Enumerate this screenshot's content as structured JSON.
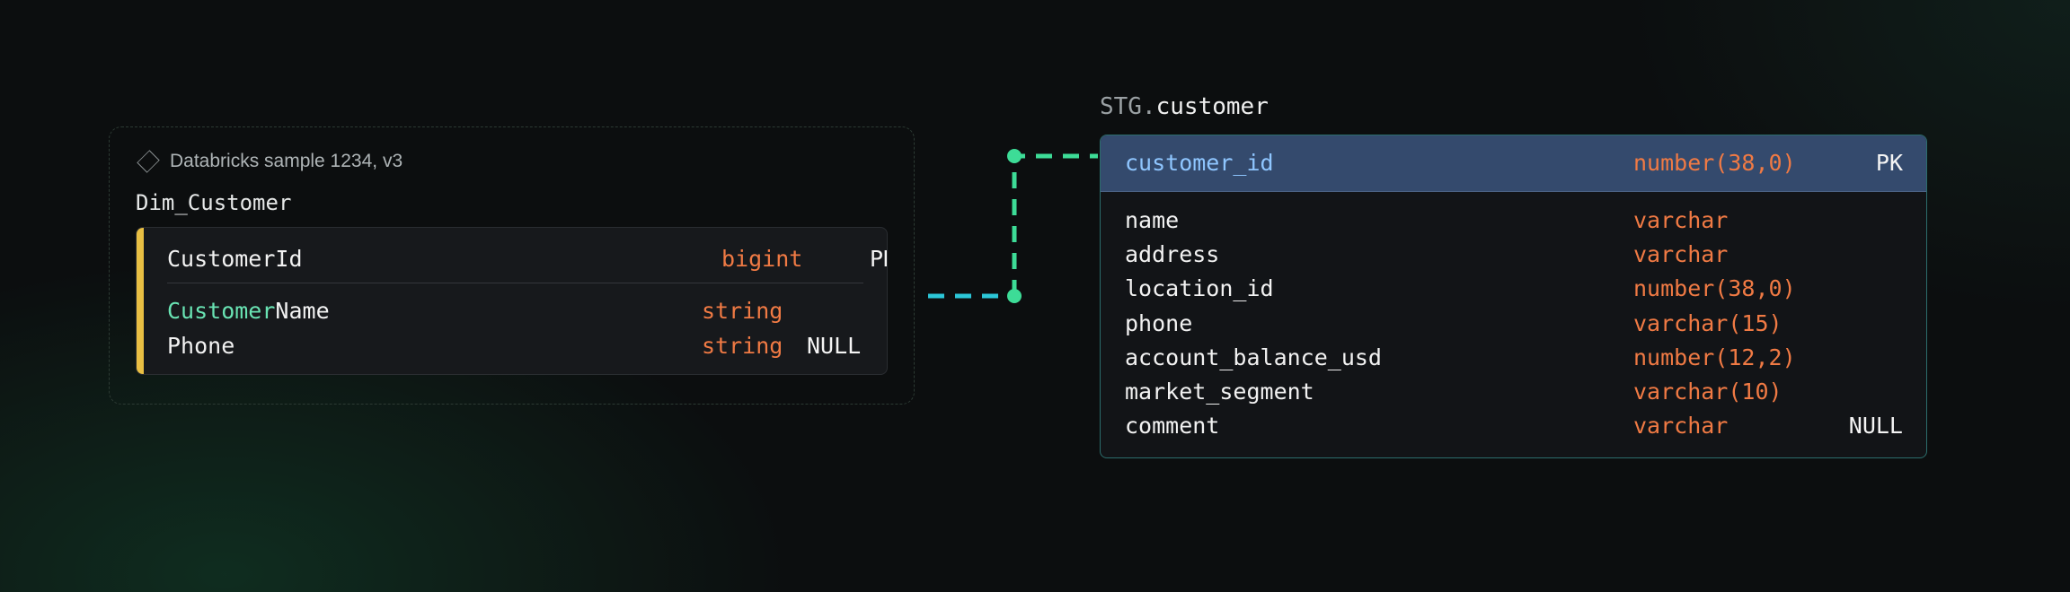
{
  "left_group": {
    "source_label": "Databricks sample 1234, v3",
    "title": "Dim_Customer",
    "columns": [
      {
        "name_highlight": "",
        "name": "CustomerId",
        "type": "bigint",
        "flag": "PK"
      },
      {
        "name_highlight": "Customer",
        "name": "Name",
        "type": "string",
        "flag": ""
      },
      {
        "name_highlight": "",
        "name": "Phone",
        "type": "string",
        "flag": "NULL"
      }
    ]
  },
  "right_table": {
    "schema": "STG.",
    "name": "customer",
    "header": {
      "name": "customer_id",
      "type": "number(38,0)",
      "flag": "PK"
    },
    "columns": [
      {
        "name": "name",
        "type": "varchar",
        "flag": ""
      },
      {
        "name": "address",
        "type": "varchar",
        "flag": ""
      },
      {
        "name": "location_id",
        "type": "number(38,0)",
        "flag": ""
      },
      {
        "name": "phone",
        "type": "varchar(15)",
        "flag": ""
      },
      {
        "name": "account_balance_usd",
        "type": "number(12,2)",
        "flag": ""
      },
      {
        "name": "market_segment",
        "type": "varchar(10)",
        "flag": ""
      },
      {
        "name": "comment",
        "type": "varchar",
        "flag": "NULL"
      }
    ]
  },
  "colors": {
    "accent_yellow": "#e9bf43",
    "type_orange": "#f07a44",
    "connector_green": "#3ddc97",
    "connector_cyan": "#2cc7d8",
    "header_blue": "#344a6d"
  }
}
